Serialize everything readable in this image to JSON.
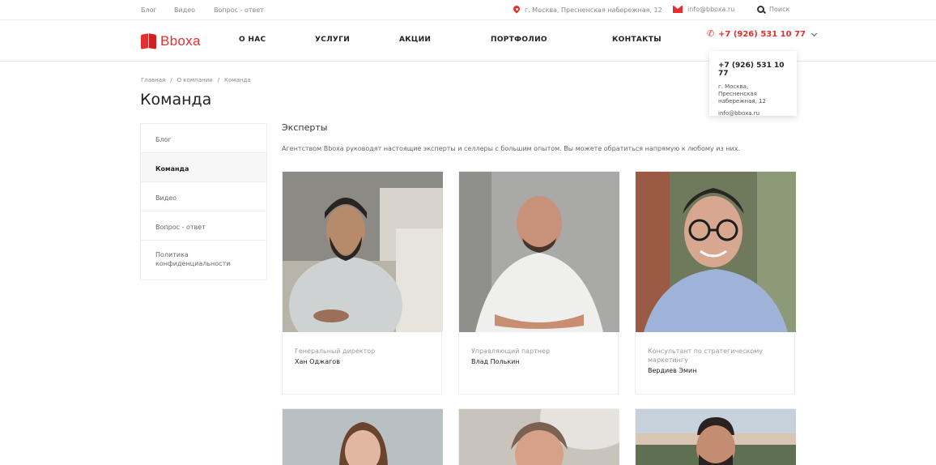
{
  "topbar": {
    "links": [
      "Блог",
      "Видео",
      "Вопрос - ответ"
    ],
    "address": "г. Москва, Пресненская набережная, 12",
    "email": "info@bboxa.ru",
    "search_label": "Поиск"
  },
  "header": {
    "logo_text": "Bboxa",
    "nav": [
      "О НАС",
      "УСЛУГИ",
      "АКЦИИ",
      "ПОРТФОЛИО",
      "КОНТАКТЫ"
    ],
    "phone": "+7 (926) 531 10 77"
  },
  "popup": {
    "phone": "+7 (926) 531 10 77",
    "address": "г. Москва, Пресненская набережная, 12",
    "email": "info@bboxa.ru"
  },
  "breadcrumb": [
    "Главная",
    "/",
    "О компании",
    "/",
    "Команда"
  ],
  "page_title": "Команда",
  "sidebar": {
    "items": [
      {
        "label": "Блог"
      },
      {
        "label": "Команда"
      },
      {
        "label": "Видео"
      },
      {
        "label": "Вопрос - ответ"
      },
      {
        "label": "Политика конфиденциальности"
      }
    ]
  },
  "main": {
    "section_title": "Эксперты",
    "description": "Агентством Bboxa руководят настоящие эксперты и селлеры с большим опытом. Вы можете обратиться напрямую к любому из них.",
    "team": [
      {
        "role": "Генеральный директор",
        "name": "Хан Оджагов"
      },
      {
        "role": "Управляющий партнер",
        "name": "Влад Полькин"
      },
      {
        "role": "Консультант по стратегическому маркетингу",
        "name": "Вердиев Эмин"
      }
    ]
  },
  "colors": {
    "accent": "#e52f2f"
  }
}
